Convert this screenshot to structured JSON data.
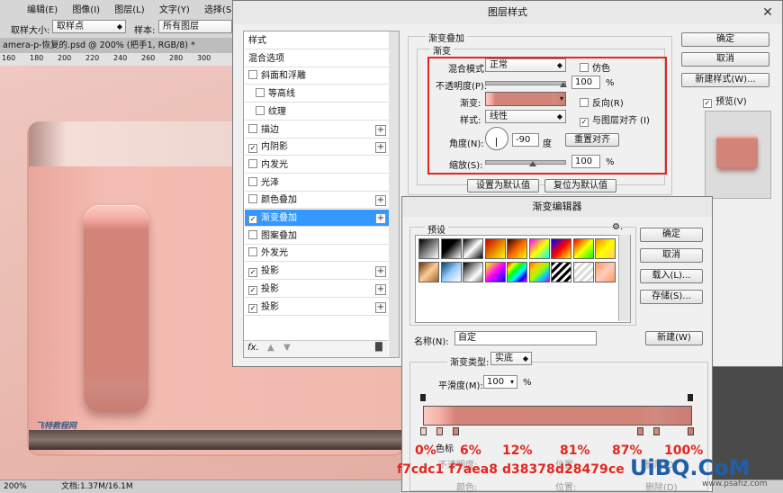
{
  "ps": {
    "options": {
      "sample_size_label": "取样大小:",
      "sample_size_value": "取样点",
      "sample_label": "样本:",
      "sample_value": "所有图层"
    },
    "menu": [
      "编辑(E)",
      "图像(I)",
      "图层(L)",
      "文字(Y)",
      "选择(S)"
    ],
    "doc_tab": "amera-p-恢复的.psd @ 200% (把手1, RGB/8) *",
    "ruler_ticks": [
      "160",
      "180",
      "200",
      "220",
      "240",
      "260",
      "280",
      "300"
    ],
    "status_zoom": "200%",
    "status_doc": "文档:1.37M/16.1M",
    "watermark": "飞特教程网"
  },
  "layer_style": {
    "title": "图层样式",
    "list": [
      {
        "label": "样式",
        "checkbox": false,
        "checked": false,
        "plus": false
      },
      {
        "label": "混合选项",
        "checkbox": false,
        "checked": false,
        "plus": false
      },
      {
        "label": "斜面和浮雕",
        "checkbox": true,
        "checked": false,
        "plus": false
      },
      {
        "label": "等高线",
        "checkbox": true,
        "checked": false,
        "plus": false,
        "indent": true
      },
      {
        "label": "纹理",
        "checkbox": true,
        "checked": false,
        "plus": false,
        "indent": true
      },
      {
        "label": "描边",
        "checkbox": true,
        "checked": false,
        "plus": true
      },
      {
        "label": "内阴影",
        "checkbox": true,
        "checked": true,
        "plus": true
      },
      {
        "label": "内发光",
        "checkbox": true,
        "checked": false,
        "plus": false
      },
      {
        "label": "光泽",
        "checkbox": true,
        "checked": false,
        "plus": false
      },
      {
        "label": "颜色叠加",
        "checkbox": true,
        "checked": false,
        "plus": true
      },
      {
        "label": "渐变叠加",
        "checkbox": true,
        "checked": true,
        "plus": true,
        "selected": true
      },
      {
        "label": "图案叠加",
        "checkbox": true,
        "checked": false,
        "plus": false
      },
      {
        "label": "外发光",
        "checkbox": true,
        "checked": false,
        "plus": false
      },
      {
        "label": "投影",
        "checkbox": true,
        "checked": true,
        "plus": true
      },
      {
        "label": "投影",
        "checkbox": true,
        "checked": true,
        "plus": true
      },
      {
        "label": "投影",
        "checkbox": true,
        "checked": true,
        "plus": true
      }
    ],
    "bottom_fx": "fx.",
    "section_title": "渐变叠加",
    "group_title": "渐变",
    "blend_mode_label": "混合模式:",
    "blend_mode_value": "正常",
    "dither_label": "仿色",
    "opacity_label": "不透明度(P):",
    "opacity_value": "100",
    "opacity_unit": "%",
    "gradient_label": "渐变:",
    "reverse_label": "反向(R)",
    "style_label": "样式:",
    "style_value": "线性",
    "align_label": "与图层对齐 (I)",
    "angle_label": "角度(N):",
    "angle_value": "-90",
    "angle_unit": "度",
    "reset_align_button": "重置对齐",
    "scale_label": "缩放(S):",
    "scale_value": "100",
    "scale_unit": "%",
    "set_default_button": "设置为默认值",
    "reset_default_button": "复位为默认值",
    "ok_button": "确定",
    "cancel_button": "取消",
    "new_style_button": "新建样式(W)...",
    "preview_label": "预览(V)"
  },
  "gradient_editor": {
    "title": "渐变编辑器",
    "presets_label": "预设",
    "ok_button": "确定",
    "cancel_button": "取消",
    "load_button": "载入(L)...",
    "save_button": "存储(S)...",
    "name_label": "名称(N):",
    "name_value": "自定",
    "new_button": "新建(W)",
    "type_label": "渐变类型:",
    "type_value": "实底",
    "smooth_label": "平滑度(M):",
    "smooth_value": "100",
    "smooth_unit": "%",
    "stops_group": "色标",
    "opacity_label": "不透明度:",
    "position_label": "位置:",
    "delete_label": "删除(D)",
    "color_label": "颜色:",
    "position2_label": "位置:",
    "delete2_label": "删除(D)"
  },
  "annotation": {
    "percents": [
      "0%",
      "6%",
      "12%",
      "81%",
      "87%",
      "100%"
    ],
    "colors": [
      "f7cdc1",
      "f7aea8",
      "d38378",
      "d28479",
      "ce"
    ]
  },
  "watermark_site": "UiBQ.CoM",
  "watermark_url": "www.psahz.com",
  "colors": {
    "gradient_stops": [
      "#f7cdc1",
      "#f7aea8",
      "#d38378",
      "#d28479",
      "#cf8a80",
      "#c97c72"
    ],
    "highlight_red": "#e2261f",
    "selection_blue": "#3399ff"
  }
}
